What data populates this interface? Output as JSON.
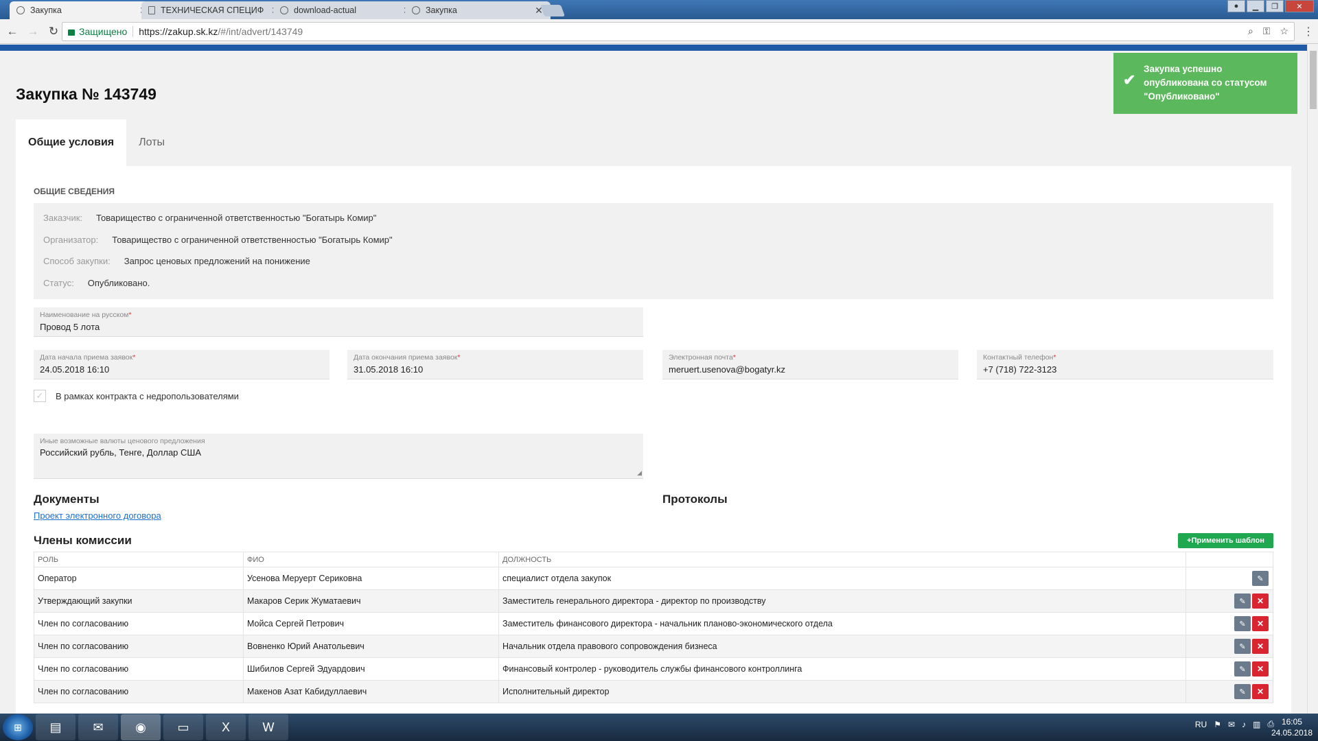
{
  "browser": {
    "tabs": [
      {
        "title": "Закупка"
      },
      {
        "title": "ТЕХНИЧЕСКАЯ СПЕЦИФ"
      },
      {
        "title": "download-actual"
      },
      {
        "title": "Закупка"
      }
    ],
    "secure_label": "Защищено",
    "url_host": "https://zakup.sk.kz",
    "url_path": "/#/int/advert/143749"
  },
  "page": {
    "title": "Закупка № 143749",
    "tabs": [
      "Общие условия",
      "Лоты"
    ],
    "section_title": "ОБЩИЕ СВЕДЕНИЯ",
    "info": [
      {
        "label": "Заказчик:",
        "value": "Товарищество с ограниченной ответственностью \"Богатырь Комир\""
      },
      {
        "label": "Организатор:",
        "value": "Товарищество с ограниченной ответственностью \"Богатырь Комир\""
      },
      {
        "label": "Способ закупки:",
        "value": "Запрос ценовых предложений на понижение"
      },
      {
        "label": "Статус:",
        "value": "Опубликовано."
      }
    ],
    "fields": {
      "name_ru": {
        "label": "Наименование на русском",
        "value": "Провод 5 лота"
      },
      "date_start": {
        "label": "Дата начала приема заявок",
        "value": "24.05.2018 16:10"
      },
      "date_end": {
        "label": "Дата окончания приема заявок",
        "value": "31.05.2018 16:10"
      },
      "email": {
        "label": "Электронная почта",
        "value": "meruert.usenova@bogatyr.kz"
      },
      "phone": {
        "label": "Контактный телефон",
        "value": "+7 (718) 722-3123"
      },
      "currencies": {
        "label": "Иные возможные валюты ценового предложения",
        "value": "Российский  рубль, Тенге, Доллар США"
      }
    },
    "required_mark": "*",
    "checkbox_label": "В рамках контракта с недропользователями",
    "documents_title": "Документы",
    "documents_link": "Проект электронного договора",
    "protocols_title": "Протоколы",
    "commission_title": "Члены комиссии",
    "apply_template_label": "+Применить шаблон",
    "table": {
      "headers": [
        "РОЛЬ",
        "ФИО",
        "ДОЛЖНОСТЬ"
      ],
      "rows": [
        [
          "Оператор",
          "Усенова Меруерт Сериковна",
          "специалист отдела закупок"
        ],
        [
          "Утверждающий закупки",
          "Макаров Серик Жуматаевич",
          "Заместитель генерального директора - директор по производству"
        ],
        [
          "Член по согласованию",
          "Мойса Сергей Петрович",
          "Заместитель финансового директора - начальник планово-экономического отдела"
        ],
        [
          "Член по согласованию",
          "Вовненко Юрий Анатольевич",
          "Начальник отдела правового сопровождения бизнеса"
        ],
        [
          "Член по согласованию",
          "Шибилов Сергей Эдуардович",
          "Финансовый контролер - руководитель службы финансового контроллинга"
        ],
        [
          "Член по согласованию",
          "Макенов Азат Кабидуллаевич",
          "Исполнительный директор"
        ]
      ]
    },
    "toast": "Закупка успешно опубликована со статусом \"Опубликовано\""
  },
  "taskbar": {
    "lang": "RU",
    "time": "16:05",
    "date": "24.05.2018"
  }
}
